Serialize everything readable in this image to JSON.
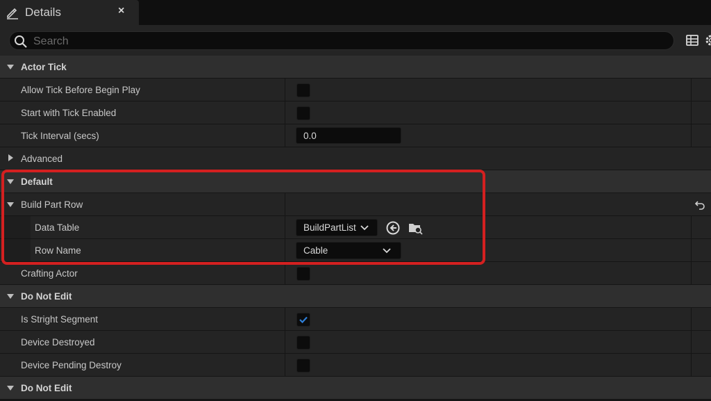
{
  "panel": {
    "tab_title": "Details",
    "close_glyph": "×",
    "icons": {
      "tab": "edit-pencil-icon",
      "close": "close-icon",
      "search": "search-icon",
      "view_options": "table-grid-icon",
      "settings": "gear-icon"
    }
  },
  "search": {
    "placeholder": "Search",
    "value": ""
  },
  "rows": {
    "actor_tick": {
      "label": "Actor Tick"
    },
    "allow_tick": {
      "label": "Allow Tick Before Begin Play",
      "checked": false
    },
    "start_tick": {
      "label": "Start with Tick Enabled",
      "checked": false
    },
    "tick_interval": {
      "label": "Tick Interval (secs)",
      "value": "0.0"
    },
    "advanced": {
      "label": "Advanced"
    },
    "default_cat": {
      "label": "Default"
    },
    "build_part_row": {
      "label": "Build Part Row"
    },
    "data_table": {
      "label": "Data Table",
      "value": "BuildPartList"
    },
    "row_name": {
      "label": "Row Name",
      "value": "Cable"
    },
    "crafting_actor": {
      "label": "Crafting Actor",
      "checked": false
    },
    "do_not_edit_1": {
      "label": "Do Not Edit"
    },
    "is_straight": {
      "label": "Is Stright Segment",
      "checked": true
    },
    "device_destroyed": {
      "label": "Device Destroyed",
      "checked": false
    },
    "device_pending": {
      "label": "Device Pending Destroy",
      "checked": false
    },
    "do_not_edit_2": {
      "label": "Do Not Edit"
    }
  },
  "colors": {
    "highlight_border": "#d42020",
    "check_accent": "#2f7fd8"
  }
}
